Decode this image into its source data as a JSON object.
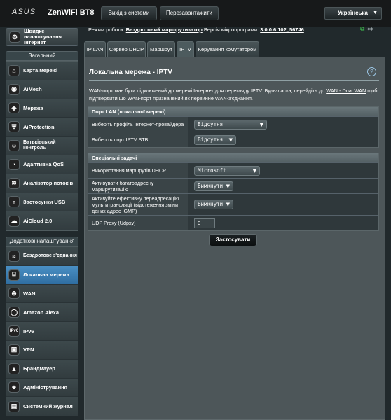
{
  "header": {
    "logo": "ASUS",
    "model": "ZenWiFi BT8",
    "logout": "Вихід з системи",
    "reboot": "Перезавантажити",
    "language": "Українська"
  },
  "status": {
    "mode_label": "Режим роботи:",
    "mode_value": "Бездротовий маршрутизатор",
    "fw_label": "Версія мікропрограми:",
    "fw_value": "3.0.0.6.102_56746"
  },
  "sidebar": {
    "quick_setup": "Швидке налаштування Інтернет",
    "general_title": "Загальний",
    "general": [
      {
        "label": "Карта мережі",
        "icon": "network-map-icon"
      },
      {
        "label": "AiMesh",
        "icon": "aimesh-icon"
      },
      {
        "label": "Мережа",
        "icon": "network-icon"
      },
      {
        "label": "AiProtection",
        "icon": "aiprotection-icon"
      },
      {
        "label": "Батьківський контроль",
        "icon": "parental-control-icon"
      },
      {
        "label": "Адаптивна QoS",
        "icon": "qos-icon"
      },
      {
        "label": "Аналізатор потоків",
        "icon": "traffic-analyzer-icon"
      },
      {
        "label": "Застосунки USB",
        "icon": "usb-icon"
      },
      {
        "label": "AiCloud 2.0",
        "icon": "aicloud-icon"
      }
    ],
    "advanced_title": "Додаткові налаштування",
    "advanced": [
      {
        "label": "Бездротове з'єднання",
        "icon": "wireless-icon"
      },
      {
        "label": "Локальна мережа",
        "icon": "lan-icon"
      },
      {
        "label": "WAN",
        "icon": "wan-icon"
      },
      {
        "label": "Amazon Alexa",
        "icon": "alexa-icon"
      },
      {
        "label": "IPv6",
        "icon": "ipv6-icon"
      },
      {
        "label": "VPN",
        "icon": "vpn-icon"
      },
      {
        "label": "Брандмауер",
        "icon": "firewall-icon"
      },
      {
        "label": "Адміністрування",
        "icon": "administration-icon"
      },
      {
        "label": "Системний журнал",
        "icon": "system-log-icon"
      }
    ]
  },
  "tabs": [
    "IP LAN",
    "Сервер DHCP",
    "Маршрут",
    "IPTV",
    "Керування комутатором"
  ],
  "main": {
    "title": "Локальна мережа - IPTV",
    "desc_1": "WAN-порт має бути підключений до мережі Інтернет для перегляду IPTV. Будь-ласка, перейдіть до ",
    "desc_link": "WAN - Dual WAN",
    "desc_2": " щоб підтвердити що WAN-порт призначений як первинне WAN-з'єднання.",
    "lan_port_section": {
      "title": "Порт LAN (локальної мережі)",
      "rows": [
        {
          "label": "Виберіть профіль Інтернет-провайдера",
          "value": "Відсутня"
        },
        {
          "label": "Виберіть порт IPTV STB",
          "value": "Відсутня"
        }
      ]
    },
    "special_section": {
      "title": "Спеціальні задачі",
      "rows": [
        {
          "label": "Використання маршрутів DHCP",
          "value": "Microsoft"
        },
        {
          "label": "Активувати багатоадресну маршрутизацію",
          "value": "Вимкнути"
        },
        {
          "label": "Активуйте ефективну переадресацію мультитрансляції (відстеження зміни даних адрес IGMP)",
          "value": "Вимкнути"
        },
        {
          "label": "UDP Proxy (Udpxy)",
          "value": "0"
        }
      ]
    },
    "apply": "Застосувати"
  }
}
